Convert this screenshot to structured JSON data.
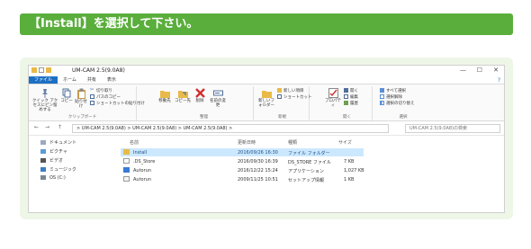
{
  "banner": {
    "text": "【Install】を選択して下さい。"
  },
  "window": {
    "title": "UM-CAM 2.5(9.0A8)",
    "controls": {
      "minimize": "—",
      "maximize": "☐",
      "close": "✕"
    }
  },
  "ribbon": {
    "tabs": [
      "ファイル",
      "ホーム",
      "共有",
      "表示"
    ],
    "help": "?",
    "clipboard": {
      "pin": "クイック アクセスにピン留めする",
      "copy": "コピー",
      "paste": "貼り付け",
      "cut": "切り取り",
      "copy_path": "パスのコピー",
      "paste_shortcut": "ショートカットの貼り付け",
      "label": "クリップボード"
    },
    "organize": {
      "move_to": "移動先",
      "copy_to": "コピー先",
      "delete": "削除",
      "rename": "名前の変更",
      "label": "整理"
    },
    "new": {
      "new_folder": "新しいフォルダー",
      "new_item": "新しい項目",
      "easy_access": "ショートカット",
      "label": "新規"
    },
    "open": {
      "properties": "プロパティ",
      "open_btn": "開く",
      "edit": "編集",
      "history": "履歴",
      "label": "開く"
    },
    "select": {
      "select_all": "すべて選択",
      "select_none": "選択解除",
      "invert": "選択の切り替え",
      "label": "選択"
    }
  },
  "addressbar": {
    "back": "←",
    "forward": "→",
    "up": "↑",
    "path": "> UM-CAM 2.5(9.0A8) > UM-CAM 2.5(9.0A8) > UM-CAM 2.5(9.0A8) >",
    "search_placeholder": "UM-CAM 2.5(9.0A8)の検索"
  },
  "navpane": {
    "items": [
      "ドキュメント",
      "ピクチャ",
      "ビデオ",
      "ミュージック",
      "OS (C:)"
    ]
  },
  "filelist": {
    "columns": [
      "名前",
      "更新日時",
      "種類",
      "サイズ"
    ],
    "rows": [
      {
        "name": "Install",
        "date": "2016/09/26 16:30",
        "type": "ファイル フォルダー",
        "size": ""
      },
      {
        "name": ".DS_Store",
        "date": "2016/09/30 16:39",
        "type": "DS_STORE ファイル",
        "size": "7 KB"
      },
      {
        "name": "Autorun",
        "date": "2016/12/22 15:24",
        "type": "アプリケーション",
        "size": "1,027 KB"
      },
      {
        "name": "Autorun",
        "date": "2009/11/25 10:51",
        "type": "セットアップ情報",
        "size": "1 KB"
      }
    ]
  },
  "colors": {
    "banner": "#5aae3c",
    "frame": "#eef6e8",
    "file_tab": "#1e6fc3",
    "selection": "#cce8ff"
  }
}
